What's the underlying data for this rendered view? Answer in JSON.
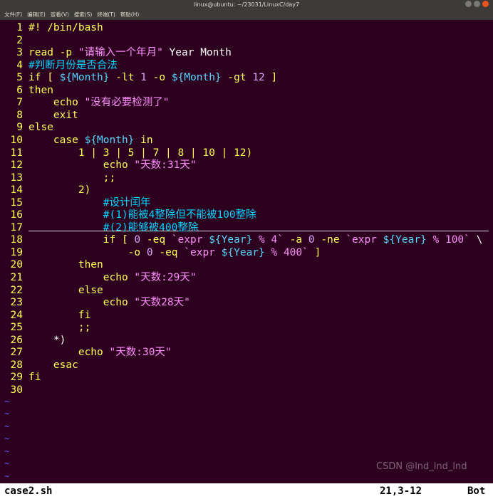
{
  "window": {
    "title": "linux@ubuntu: ~/23031/LinuxC/day7"
  },
  "menu": [
    "文件(F)",
    "编辑(E)",
    "查看(V)",
    "搜索(S)",
    "终端(T)",
    "帮助(H)"
  ],
  "lines": [
    {
      "n": "1",
      "segs": [
        {
          "t": "#! /bin/bash",
          "c": "kw"
        }
      ]
    },
    {
      "n": "2",
      "segs": []
    },
    {
      "n": "3",
      "segs": [
        {
          "t": "read -p ",
          "c": "kw"
        },
        {
          "t": "\"请输入一个年月\"",
          "c": "str"
        },
        {
          "t": " Year Month",
          "c": "plain"
        }
      ]
    },
    {
      "n": "4",
      "segs": [
        {
          "t": "#判断月份是否合法",
          "c": "cmt"
        }
      ]
    },
    {
      "n": "5",
      "segs": [
        {
          "t": "if [ ",
          "c": "kw"
        },
        {
          "t": "${Month}",
          "c": "var"
        },
        {
          "t": " -lt ",
          "c": "kw"
        },
        {
          "t": "1",
          "c": "num"
        },
        {
          "t": " -o ",
          "c": "kw"
        },
        {
          "t": "${Month}",
          "c": "var"
        },
        {
          "t": " -gt ",
          "c": "kw"
        },
        {
          "t": "12",
          "c": "num"
        },
        {
          "t": " ]",
          "c": "kw"
        }
      ]
    },
    {
      "n": "6",
      "segs": [
        {
          "t": "then",
          "c": "kw"
        }
      ]
    },
    {
      "n": "7",
      "segs": [
        {
          "t": "    echo ",
          "c": "kw"
        },
        {
          "t": "\"没有必要检测了\"",
          "c": "str"
        }
      ]
    },
    {
      "n": "8",
      "segs": [
        {
          "t": "    exit",
          "c": "kw"
        }
      ]
    },
    {
      "n": "9",
      "segs": [
        {
          "t": "else",
          "c": "kw"
        }
      ]
    },
    {
      "n": "10",
      "segs": [
        {
          "t": "    case ",
          "c": "kw"
        },
        {
          "t": "${Month}",
          "c": "var"
        },
        {
          "t": " in",
          "c": "kw"
        }
      ]
    },
    {
      "n": "11",
      "segs": [
        {
          "t": "        1 | 3 | 5 | 7 | 8 | 10 | 12)",
          "c": "kw"
        }
      ]
    },
    {
      "n": "12",
      "segs": [
        {
          "t": "            echo ",
          "c": "kw"
        },
        {
          "t": "\"天数:31天\"",
          "c": "str"
        }
      ]
    },
    {
      "n": "13",
      "segs": [
        {
          "t": "            ;;",
          "c": "kw"
        }
      ]
    },
    {
      "n": "14",
      "segs": [
        {
          "t": "        2)",
          "c": "kw"
        }
      ]
    },
    {
      "n": "15",
      "segs": [
        {
          "t": "            #设计闰年",
          "c": "cmt"
        }
      ]
    },
    {
      "n": "16",
      "segs": [
        {
          "t": "            #(1)能被4整除但不能被100整除",
          "c": "cmt"
        }
      ]
    },
    {
      "n": "17",
      "segs": [
        {
          "t": "            #(2)能够被400整除",
          "c": "cmt"
        }
      ]
    },
    {
      "n": "18",
      "segs": [
        {
          "t": "            if [ ",
          "c": "kw"
        },
        {
          "t": "0",
          "c": "num"
        },
        {
          "t": " -eq ",
          "c": "kw"
        },
        {
          "t": "`expr ",
          "c": "str"
        },
        {
          "t": "${Year}",
          "c": "var"
        },
        {
          "t": " % 4` ",
          "c": "str"
        },
        {
          "t": "-a ",
          "c": "kw"
        },
        {
          "t": "0",
          "c": "num"
        },
        {
          "t": " -ne ",
          "c": "kw"
        },
        {
          "t": "`expr ",
          "c": "str"
        },
        {
          "t": "${Year}",
          "c": "var"
        },
        {
          "t": " % 100`",
          "c": "str"
        },
        {
          "t": " \\",
          "c": "plain"
        }
      ]
    },
    {
      "n": "19",
      "segs": [
        {
          "t": "                -o ",
          "c": "kw"
        },
        {
          "t": "0",
          "c": "num"
        },
        {
          "t": " -eq ",
          "c": "kw"
        },
        {
          "t": "`expr ",
          "c": "str"
        },
        {
          "t": "${Year}",
          "c": "var"
        },
        {
          "t": " % 400`",
          "c": "str"
        },
        {
          "t": " ]",
          "c": "kw"
        }
      ]
    },
    {
      "n": "20",
      "segs": [
        {
          "t": "        then",
          "c": "kw"
        }
      ]
    },
    {
      "n": "21",
      "segs": [
        {
          "t": "            echo ",
          "c": "kw"
        },
        {
          "t": "\"天数:29天\"",
          "c": "str"
        }
      ]
    },
    {
      "n": "22",
      "segs": [
        {
          "t": "        else",
          "c": "kw"
        }
      ]
    },
    {
      "n": "23",
      "segs": [
        {
          "t": "            echo ",
          "c": "kw"
        },
        {
          "t": "\"天数28天\"",
          "c": "str"
        }
      ]
    },
    {
      "n": "24",
      "segs": [
        {
          "t": "        fi",
          "c": "kw"
        }
      ]
    },
    {
      "n": "25",
      "segs": [
        {
          "t": "        ;;",
          "c": "kw"
        }
      ]
    },
    {
      "n": "26",
      "segs": [
        {
          "t": "    *)",
          "c": "plain"
        }
      ]
    },
    {
      "n": "27",
      "segs": [
        {
          "t": "        echo ",
          "c": "kw"
        },
        {
          "t": "\"天数:30天\"",
          "c": "str"
        }
      ]
    },
    {
      "n": "28",
      "segs": [
        {
          "t": "    esac",
          "c": "kw"
        }
      ]
    },
    {
      "n": "29",
      "segs": [
        {
          "t": "fi",
          "c": "kw"
        }
      ]
    },
    {
      "n": "30",
      "segs": []
    }
  ],
  "tilde_char": "~",
  "status": {
    "filename": "case2.sh",
    "position": "21,3-12",
    "scroll": "Bot"
  },
  "watermark": "CSDN @lnd_lnd_lnd"
}
